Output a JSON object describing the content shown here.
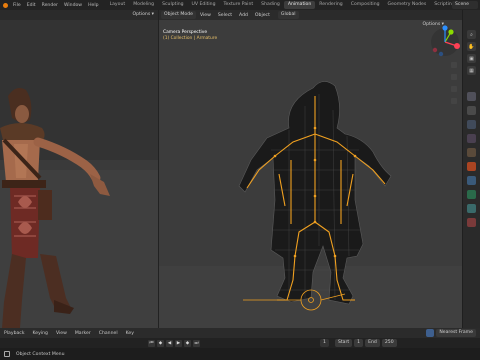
{
  "topbar": {
    "menus": [
      "File",
      "Edit",
      "Render",
      "Window",
      "Help"
    ],
    "workspaces": [
      "Layout",
      "Modeling",
      "Sculpting",
      "UV Editing",
      "Texture Paint",
      "Shading",
      "Animation",
      "Rendering",
      "Compositing",
      "Geometry Nodes",
      "Scripting"
    ],
    "active_workspace": "Animation",
    "scene": "Scene"
  },
  "left_view": {
    "options_label": "Options ▾"
  },
  "main_view": {
    "mode": "Object Mode",
    "menus": [
      "View",
      "Select",
      "Add",
      "Object"
    ],
    "orientation": "Global",
    "options_label": "Options ▾",
    "camera_title": "Camera Perspective",
    "collection_label": "(1) Collection | Armature"
  },
  "timeline": {
    "menus": [
      "Playback",
      "Keying",
      "View",
      "Marker",
      "Channel",
      "Key"
    ],
    "keying": "Nearest Frame",
    "current_frame": "1",
    "start_label": "Start",
    "start": "1",
    "end_label": "End",
    "end": "250"
  },
  "status": {
    "text": "Object Context Menu"
  },
  "colors": {
    "accent": "#e87d0d",
    "bone": "#f0a020",
    "x_axis": "#ff4055",
    "y_axis": "#8bdc00",
    "z_axis": "#2c8fff"
  }
}
